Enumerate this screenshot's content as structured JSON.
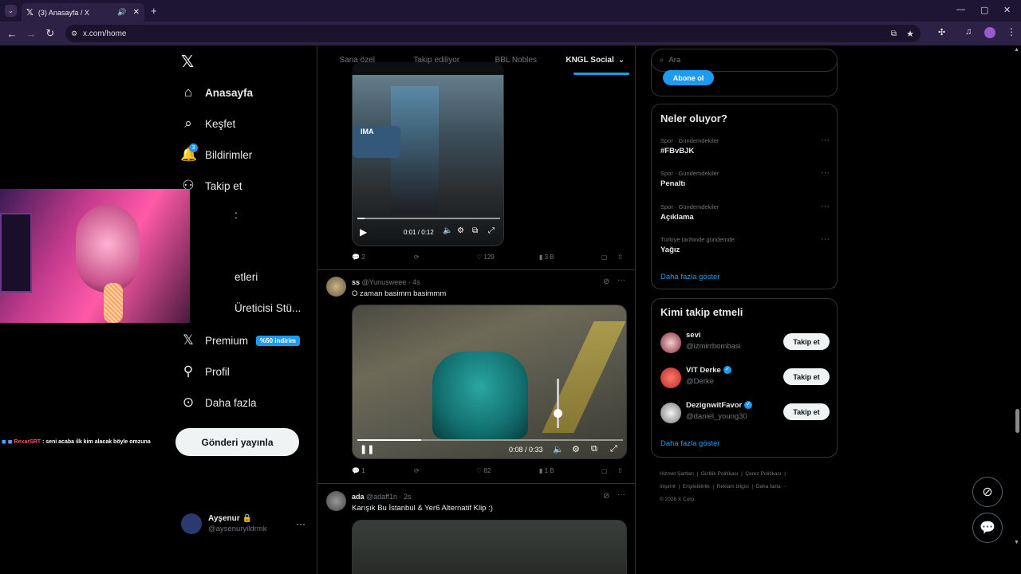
{
  "browser": {
    "tab_title": "(3) Anasayfa / X",
    "url": "x.com/home"
  },
  "nav": {
    "items": [
      {
        "label": "Anasayfa",
        "icon": "home-icon",
        "badge": ""
      },
      {
        "label": "Keşfet",
        "icon": "search-icon",
        "badge": ""
      },
      {
        "label": "Bildirimler",
        "icon": "bell-icon",
        "badge": "3"
      },
      {
        "label": "Takip et",
        "icon": "person-add-icon",
        "badge": ""
      },
      {
        "label": ":",
        "icon": "",
        "badge": ""
      },
      {
        "label": "etleri",
        "icon": "",
        "badge": ""
      },
      {
        "label": "Üreticisi Stü...",
        "icon": "",
        "badge": ""
      },
      {
        "label": "Premium",
        "icon": "x-icon",
        "badge": "%50 indirim"
      },
      {
        "label": "Profil",
        "icon": "person-icon",
        "badge": ""
      },
      {
        "label": "Daha fazla",
        "icon": "more-circle-icon",
        "badge": ""
      }
    ],
    "post_button": "Gönderi yayınla"
  },
  "account": {
    "name": "Ayşenur",
    "handle": "@aysenuryildrmk"
  },
  "chat_overlay": {
    "user": "RexarSRT",
    "message": ": seni acaba ilk kim alacak böyle omzuna"
  },
  "timeline": {
    "tabs": [
      "Sana özel",
      "Takip ediliyor",
      "BBL Nobles",
      "KNGL Social"
    ],
    "active_tab": "KNGL Social",
    "tweets": [
      {
        "video_time": "0:01 / 0:12",
        "overlay_text": "IMA",
        "replies": "2",
        "retweets": "",
        "likes": "129",
        "views": "3 B"
      },
      {
        "name": "ss",
        "handle": "@Yunusweee",
        "time": "4s",
        "text": "O zaman basimm basimmm",
        "video_time": "0:08 / 0:33",
        "replies": "1",
        "retweets": "",
        "likes": "82",
        "views": "1 B"
      },
      {
        "name": "ada",
        "handle": "@adaff1n",
        "time": "2s",
        "text": "Karışık Bu İstanbul & Yer6 Alternatif Klip :)"
      }
    ]
  },
  "right": {
    "search_placeholder": "Ara",
    "subscribe_label": "Abone ol",
    "trends_title": "Neler oluyor?",
    "trends": [
      {
        "category": "Spor · Gündemdekiler",
        "name": "#FBvBJK"
      },
      {
        "category": "Spor · Gündemdekiler",
        "name": "Penaltı"
      },
      {
        "category": "Spor · Gündemdekiler",
        "name": "Açıklama"
      },
      {
        "category": "Türkiye tarihinde gündemde",
        "name": "Yağız"
      }
    ],
    "show_more": "Daha fazla göster",
    "who_title": "Kimi takip etmeli",
    "who": [
      {
        "name": "sevi",
        "handle": "@izmirrbombasi",
        "verified": false,
        "button": "Takip et"
      },
      {
        "name": "VIT Derke",
        "handle": "@Derke",
        "verified": true,
        "button": "Takip et"
      },
      {
        "name": "DezignwitFavor",
        "handle": "@daniel_young30",
        "verified": true,
        "button": "Takip et"
      }
    ],
    "who_more": "Daha fazla göster",
    "footer": [
      "Hizmet Şartları",
      "Gizlilik Politikası",
      "Çerez Politikası",
      "Imprint",
      "Erişilebilirlik",
      "Reklam bilgisi",
      "Daha fazla ···",
      "© 2026 X Corp."
    ]
  }
}
